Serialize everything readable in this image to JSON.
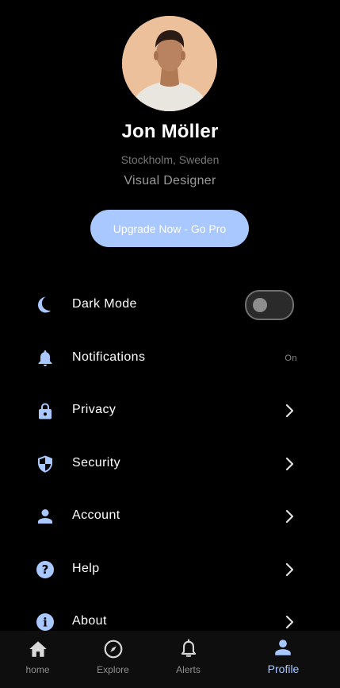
{
  "profile": {
    "name": "Jon Möller",
    "location": "Stockholm, Sweden",
    "role": "Visual Designer",
    "upgrade_label": "Upgrade Now - Go Pro"
  },
  "menu": {
    "dark_mode": {
      "label": "Dark Mode",
      "icon": "moon-icon",
      "enabled": false
    },
    "notifications": {
      "label": "Notifications",
      "icon": "bell-icon",
      "status": "On"
    },
    "privacy": {
      "label": "Privacy",
      "icon": "lock-icon"
    },
    "security": {
      "label": "Security",
      "icon": "shield-icon"
    },
    "account": {
      "label": "Account",
      "icon": "person-icon"
    },
    "help": {
      "label": "Help",
      "icon": "help-circle-icon"
    },
    "about": {
      "label": "About",
      "icon": "info-icon"
    }
  },
  "nav": {
    "home": {
      "label": "home",
      "icon": "home-icon"
    },
    "explore": {
      "label": "Explore",
      "icon": "compass-icon"
    },
    "alerts": {
      "label": "Alerts",
      "icon": "bell-outline-icon"
    },
    "profile": {
      "label": "Profile",
      "icon": "person-icon",
      "active": true
    }
  },
  "colors": {
    "accent": "#a8c8ff",
    "background": "#000000",
    "nav_background": "#0e0e0e",
    "muted_text": "#777777"
  }
}
